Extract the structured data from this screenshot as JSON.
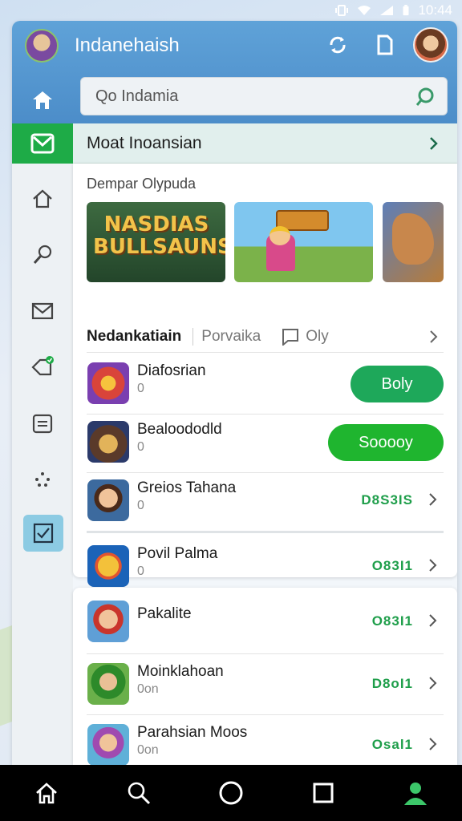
{
  "status_bar": {
    "time": "10:44"
  },
  "header": {
    "title": "Indanehaish"
  },
  "search": {
    "value": "Qo Indamia"
  },
  "banner": {
    "label": "Moat Inoansian"
  },
  "featured": {
    "section_title": "Dempar Olypuda",
    "tiles": [
      {
        "title_text": "NASDIAS BULLSAUNS"
      },
      {
        "title_text": ""
      },
      {
        "title_text": ""
      }
    ]
  },
  "subnav": {
    "tab1": "Nedankatiain",
    "tab2": "Porvaika",
    "tab3": "Oly"
  },
  "apps": [
    {
      "name": "Diafosrian",
      "sub": "0",
      "action_type": "pill",
      "action": "Boly",
      "color": "#1ea85a"
    },
    {
      "name": "Bealoododld",
      "sub": "0",
      "action_type": "pill",
      "action": "Sooooy",
      "color": "#1fb52f"
    },
    {
      "name": "Greios Tahana",
      "sub": "0",
      "action_type": "value",
      "action": "D8S3IS"
    },
    {
      "name": "Povil Palma",
      "sub": "0",
      "action_type": "value",
      "action": "O83I1"
    }
  ],
  "apps2": [
    {
      "name": "Pakalite",
      "sub": "",
      "action": "O83I1"
    },
    {
      "name": "Moinklahoan",
      "sub": "0on",
      "action": "D8oI1"
    },
    {
      "name": "Parahsian Moos",
      "sub": "0on",
      "action": "Osal1"
    }
  ],
  "colors": {
    "accent_green": "#1eab47",
    "header_blue": "#4f92cc",
    "value_green": "#1e9e4a"
  }
}
